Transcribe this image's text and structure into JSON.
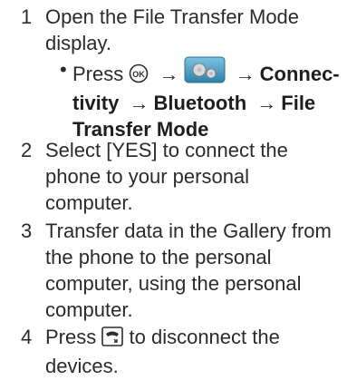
{
  "steps": [
    {
      "num": "1",
      "text": "Open the File Transfer Mode display."
    },
    {
      "num": "2",
      "text": "Select [YES] to connect the phone to your personal computer."
    },
    {
      "num": "3",
      "text": "Transfer data in the Gallery from the phone to the personal computer, using the personal computer."
    },
    {
      "num": "4",
      "text_before": "Press",
      "text_after": "to disconnect the devices."
    }
  ],
  "substep": {
    "bullet": "•",
    "press": "Press",
    "arrow": "→",
    "path": [
      "Connec-tivity",
      "Bluetooth",
      "File Transfer Mode"
    ]
  },
  "icons": {
    "ok_key": "ok-key-icon",
    "settings": "settings-gear-icon",
    "end_key": "end-call-key-icon"
  },
  "colors": {
    "text": "#2b2b2b",
    "settings_icon_start": "#6bb6d6",
    "settings_icon_end": "#3a87ad"
  }
}
